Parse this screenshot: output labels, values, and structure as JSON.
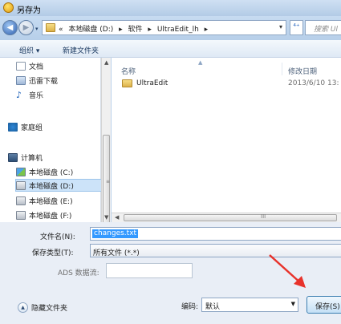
{
  "window": {
    "title": "另存为"
  },
  "address": {
    "crumbs": [
      "«",
      "本地磁盘 (D:)",
      "▸",
      "软件",
      "▸",
      "UltraEdit_lh",
      "▸"
    ],
    "refresh_glyph": "⁴⁺",
    "search_placeholder": "搜索 Ul"
  },
  "toolbar": {
    "organize_label": "组织 ▾",
    "new_folder_label": "新建文件夹"
  },
  "sidebar": {
    "items": [
      {
        "label": "文档",
        "icon": "document-icon"
      },
      {
        "label": "迅雷下载",
        "icon": "download-folder-icon"
      },
      {
        "label": "音乐",
        "icon": "music-icon"
      },
      {
        "label": "家庭组",
        "icon": "homegroup-icon"
      },
      {
        "label": "计算机",
        "icon": "computer-icon"
      },
      {
        "label": "本地磁盘 (C:)",
        "icon": "system-drive-icon"
      },
      {
        "label": "本地磁盘 (D:)",
        "icon": "drive-icon",
        "selected": true
      },
      {
        "label": "本地磁盘 (E:)",
        "icon": "drive-icon"
      },
      {
        "label": "本地磁盘 (F:)",
        "icon": "drive-icon"
      }
    ]
  },
  "file_list": {
    "columns": {
      "name": "名称",
      "date": "修改日期"
    },
    "rows": [
      {
        "name": "UltraEdit",
        "date": "2013/6/10 13:"
      }
    ],
    "scroll_grip": "III"
  },
  "form": {
    "filename_label": "文件名(N):",
    "filename_value": "changes.txt",
    "filetype_label": "保存类型(T):",
    "filetype_value": "所有文件 (*.*)",
    "ads_label": "ADS 数据流:"
  },
  "bottom": {
    "hide_folders_label": "隐藏文件夹",
    "encoding_label": "编码:",
    "encoding_value": "默认",
    "save_label": "保存(S)"
  },
  "colors": {
    "selection": "#3399ff",
    "annotation_arrow": "#e8322b"
  }
}
